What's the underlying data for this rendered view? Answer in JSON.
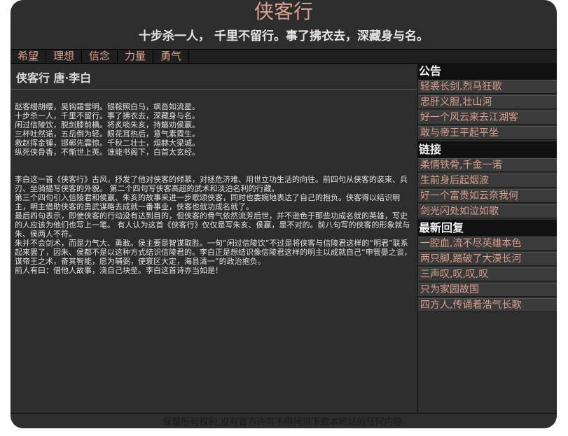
{
  "header": {
    "title": "侠客行",
    "subtitle": "十步杀一人，  千里不留行。事了拂衣去，深藏身与名。"
  },
  "nav": {
    "items": [
      "希望",
      "理想",
      "信念",
      "力量",
      "勇气"
    ]
  },
  "article": {
    "title": "侠客行  唐·李白",
    "poem_lines": [
      "赵客缦胡缨，吴钩霜雪明。银鞍照白马，飒沓如流星。",
      "十步杀一人，千里不留行。事了拂衣去，深藏身与名。",
      "闲过信陵饮，脱剑膝前横。将炙啖朱亥，持觞劝侯嬴。",
      "三杯吐然诺，五岳倒为轻。眼花耳热后，意气素霓生。",
      "救赵挥金锤，邯郸先震惊。千秋二壮士，烜赫大梁城。",
      "纵死侠骨香，不惭世上英。谁能书阁下，白首太玄经。"
    ],
    "paragraphs": [
      "李白这一首《侠客行》古风，抒发了他对侠客的倾慕，对拯危济难、用世立功生活的向往。前四句从侠客的装束、兵刃、坐骑描写侠客的外貌。  第二个四句写侠客高超的武术和淡泊名利的行藏。",
      "第三个四句引入信陵君和侯嬴、朱亥的故事来进一步歌颂侠客，同时也委婉地表达了自己的抱负。侠客得以结识明主，明主借助侠客的勇武谋略去成就一番事业，侠客也就功成名就了。",
      "最后四句表示，即使侠客的行动没有达到目的，但侠客的骨气依然流芳后世，并不逊色于那些功成名就的英雄，写史的人应该为他们也写上一笔。  有人认为这首《侠客行》仅仅是写朱亥、侯嬴，是不对的。前八句写的侠客的形象就与朱、侯两人不符。",
      "朱并不会剑术，而是力气大、勇敢。侯主要是智谋取胜。一句“闲过信陵饮”不过是将侠客与信陵君这样的“明君”联系起来罢了，因朱、侯都不是以这种方式结识信陵君的。李白正是想结识像信陵君这样的明主以成就自己“申管晏之谈，谋帝王之术，奋其智能，愿为辅弼，使寰区大定，海县清一”的政治抱负。",
      "前人有曰：借他人故事，浇自己块垒。李白这首诗亦当如是！"
    ]
  },
  "sidebar": {
    "sections": [
      {
        "heading": "公告",
        "items": [
          "轻裘长剑,烈马狂歌",
          "忠肝义胆,壮山河",
          "好一个风云来去江湖客",
          "敢与帝王平起平坐"
        ]
      },
      {
        "heading": "链接",
        "items": [
          "柔情铁骨,千金一诺",
          "生前身后起烟波",
          "好一个富贵如云奈我何",
          "剑光闪处如泣如歌"
        ]
      },
      {
        "heading": "最新回复",
        "items": [
          "一腔血,流不尽英雄本色",
          "两只脚,踏破了大漠长河",
          "三声叹,叹,叹,叹",
          "只为家园故国",
          "四方人,传诵着浩气长歌"
        ]
      }
    ]
  },
  "footer": {
    "text": "保留所有权利,没有官方许可不得拷贝下载本网站的任何内容."
  },
  "colors": {
    "background": "#2d2d2d",
    "accent": "#d9a08e",
    "text": "#e2e2e2"
  }
}
